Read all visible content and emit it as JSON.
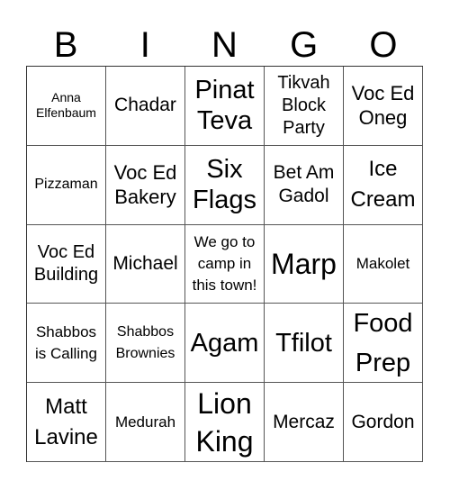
{
  "header": [
    "B",
    "I",
    "N",
    "G",
    "O"
  ],
  "cells": [
    "Anna Elfenbaum",
    "Chadar",
    "Pinat Teva",
    "Tikvah Block Party",
    "Voc Ed Oneg",
    "Pizzaman",
    "Voc Ed Bakery",
    "Six Flags",
    "Bet Am Gadol",
    "Ice Cream",
    "Voc Ed Building",
    "Michael",
    "We go to camp in this town!",
    "Marp",
    "Makolet",
    "Shabbos is Calling",
    "Shabbos Brownies",
    "Agam",
    "Tfilot",
    "Food Prep",
    "Matt Lavine",
    "Medurah",
    "Lion King",
    "Mercaz",
    "Gordon"
  ]
}
